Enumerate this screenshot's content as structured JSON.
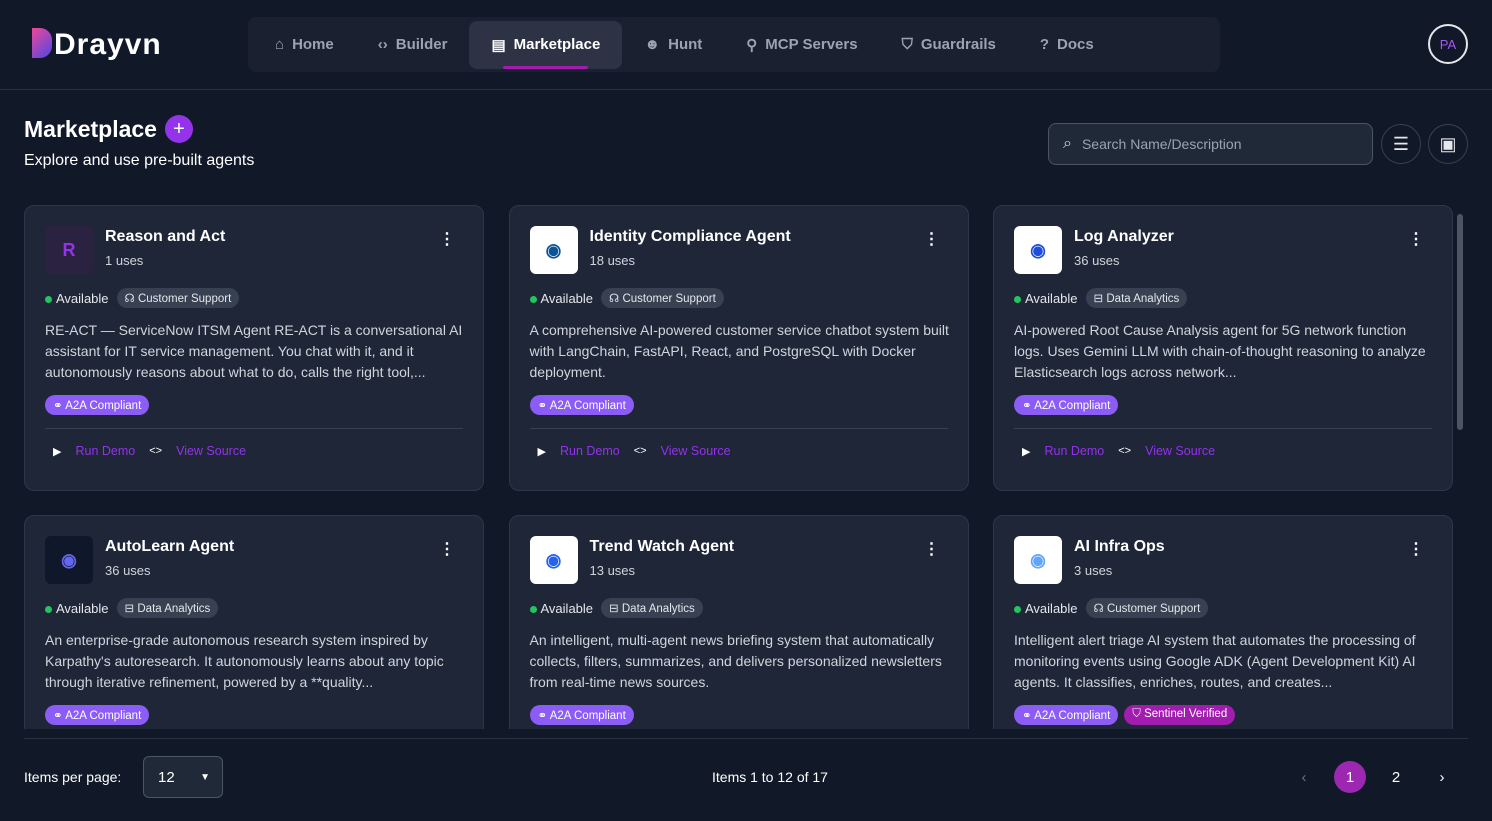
{
  "brand": "Drayvn",
  "nav": [
    {
      "label": "Home",
      "icon": "⌂"
    },
    {
      "label": "Builder",
      "icon": "‹›"
    },
    {
      "label": "Marketplace",
      "icon": "▤"
    },
    {
      "label": "Hunt",
      "icon": "☻"
    },
    {
      "label": "MCP Servers",
      "icon": "⚲"
    },
    {
      "label": "Guardrails",
      "icon": "⛉"
    },
    {
      "label": "Docs",
      "icon": "?"
    }
  ],
  "user_initials": "PA",
  "page": {
    "title": "Marketplace",
    "subtitle": "Explore and use pre-built agents",
    "search_placeholder": "Search Name/Description"
  },
  "cards": [
    {
      "name": "Reason and Act",
      "uses": "1 uses",
      "status": "Available",
      "category": "Customer Support",
      "desc": "RE-ACT — ServiceNow ITSM Agent RE-ACT is a conversational AI assistant for IT service management. You chat with it, and it autonomously reasons about what to do, calls the right tool,...",
      "badges": [
        "A2A Compliant"
      ],
      "thumb": "R"
    },
    {
      "name": "Identity Compliance Agent",
      "uses": "18 uses",
      "status": "Available",
      "category": "Customer Support",
      "desc": "A comprehensive AI-powered customer service chatbot system built with LangChain, FastAPI, React, and PostgreSQL with Docker deployment.",
      "badges": [
        "A2A Compliant"
      ],
      "thumb": ""
    },
    {
      "name": "Log Analyzer",
      "uses": "36 uses",
      "status": "Available",
      "category": "Data Analytics",
      "desc": "AI-powered Root Cause Analysis agent for 5G network function logs. Uses Gemini LLM with chain-of-thought reasoning to analyze Elasticsearch logs across network...",
      "badges": [
        "A2A Compliant"
      ],
      "thumb": ""
    },
    {
      "name": "AutoLearn Agent",
      "uses": "36 uses",
      "status": "Available",
      "category": "Data Analytics",
      "desc": "An enterprise-grade autonomous research system inspired by Karpathy's autoresearch. It autonomously learns about any topic through iterative refinement, powered by a **quality...",
      "badges": [
        "A2A Compliant"
      ],
      "thumb": ""
    },
    {
      "name": "Trend Watch Agent",
      "uses": "13 uses",
      "status": "Available",
      "category": "Data Analytics",
      "desc": "An intelligent, multi-agent news briefing system that automatically collects, filters, summarizes, and delivers personalized newsletters from real-time news sources.",
      "badges": [
        "A2A Compliant"
      ],
      "thumb": ""
    },
    {
      "name": "AI Infra Ops",
      "uses": "3 uses",
      "status": "Available",
      "category": "Customer Support",
      "desc": "Intelligent alert triage AI system that automates the processing of monitoring events using Google ADK (Agent Development Kit) AI agents. It classifies, enriches, routes, and creates...",
      "badges": [
        "A2A Compliant",
        "Sentinel Verified"
      ],
      "thumb": ""
    }
  ],
  "actions": {
    "run": "Run Demo",
    "source": "View Source"
  },
  "footer": {
    "ipp_label": "Items per page:",
    "ipp_value": "12",
    "range": "Items 1 to 12 of 17",
    "pages": [
      "1",
      "2"
    ],
    "current_page": "1"
  }
}
